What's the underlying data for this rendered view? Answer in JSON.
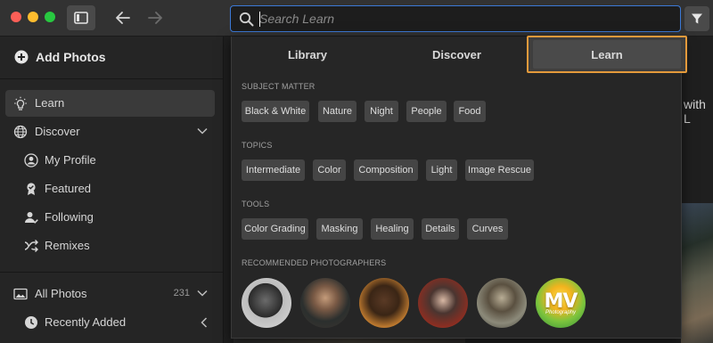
{
  "colors": {
    "accent_focus": "#3c79d6",
    "active_tab_outline": "#e49a3b",
    "chip_bg": "#454545"
  },
  "toolbar": {
    "icons": [
      "sidebar-toggle-icon",
      "back-arrow-icon",
      "forward-arrow-icon",
      "search-icon",
      "filter-icon"
    ]
  },
  "search": {
    "placeholder": "Search Learn",
    "value": ""
  },
  "sidebar": {
    "add_photos": "Add Photos",
    "items": [
      {
        "label": "Learn",
        "icon": "lightbulb-icon",
        "active": true
      },
      {
        "label": "Discover",
        "icon": "globe-icon"
      },
      {
        "label": "My Profile",
        "icon": "profile-icon"
      },
      {
        "label": "Featured",
        "icon": "badge-icon"
      },
      {
        "label": "Following",
        "icon": "following-icon"
      },
      {
        "label": "Remixes",
        "icon": "remix-icon"
      },
      {
        "label": "All Photos",
        "icon": "photos-icon",
        "count": "231"
      },
      {
        "label": "Recently Added",
        "icon": "clock-icon"
      }
    ]
  },
  "content": {
    "peek_text": "with L"
  },
  "panel": {
    "tabs": [
      "Library",
      "Discover",
      "Learn"
    ],
    "active_tab": "Learn",
    "sections": [
      {
        "title": "SUBJECT MATTER",
        "chips": [
          "Black & White",
          "Nature",
          "Night",
          "People",
          "Food"
        ]
      },
      {
        "title": "TOPICS",
        "chips": [
          "Intermediate",
          "Color",
          "Composition",
          "Light",
          "Image Rescue"
        ]
      },
      {
        "title": "TOOLS",
        "chips": [
          "Color Grading",
          "Masking",
          "Healing",
          "Details",
          "Curves"
        ]
      },
      {
        "title": "RECOMMENDED PHOTOGRAPHERS"
      }
    ],
    "photographer_logo": {
      "text": "MV",
      "sub": "Photography"
    }
  }
}
